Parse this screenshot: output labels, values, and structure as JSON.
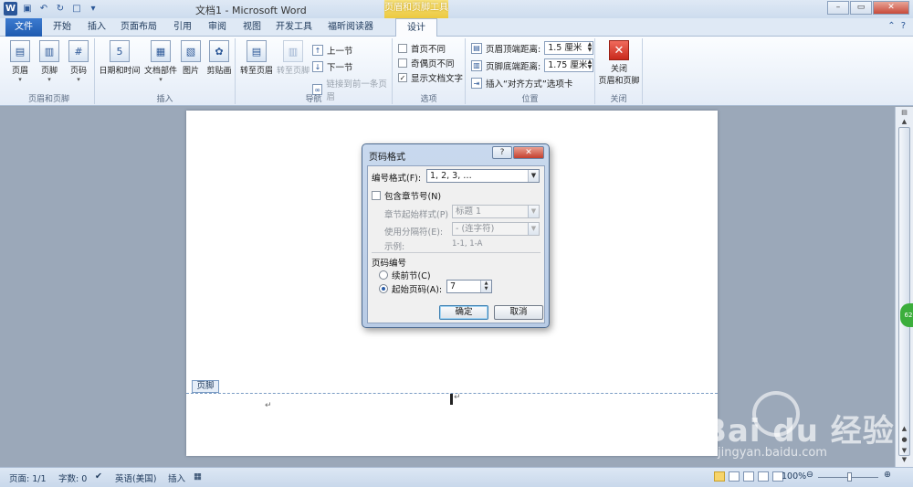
{
  "window": {
    "title": "文档1 - Microsoft Word",
    "context_tab_group": "页眉和页脚工具"
  },
  "tabs": [
    "文件",
    "开始",
    "插入",
    "页面布局",
    "引用",
    "审阅",
    "视图",
    "开发工具",
    "福昕阅读器",
    "设计"
  ],
  "ribbon": {
    "group1": {
      "label": "页眉和页脚",
      "buttons": [
        "页眉",
        "页脚",
        "页码"
      ]
    },
    "group2": {
      "label": "插入",
      "buttons": [
        "日期和时间",
        "文档部件",
        "图片",
        "剪贴画"
      ]
    },
    "group3": {
      "label": "导航",
      "goto_header": "转至页眉",
      "goto_footer": "转至页脚",
      "prev": "上一节",
      "next": "下一节",
      "link_prev": "链接到前一条页眉"
    },
    "group4": {
      "label": "选项",
      "checks": [
        {
          "label": "首页不同",
          "checked": false
        },
        {
          "label": "奇偶页不同",
          "checked": false
        },
        {
          "label": "显示文档文字",
          "checked": true
        }
      ]
    },
    "group5": {
      "label": "位置",
      "header_dist_label": "页眉顶端距离:",
      "header_dist_value": "1.5 厘米",
      "footer_dist_label": "页脚底端距离:",
      "footer_dist_value": "1.75 厘米",
      "insert_align": "插入“对齐方式”选项卡"
    },
    "group6": {
      "label": "关闭",
      "close_line1": "关闭",
      "close_line2": "页眉和页脚"
    }
  },
  "document": {
    "footer_tag": "页脚"
  },
  "dialog": {
    "title": "页码格式",
    "number_format_label": "编号格式(F):",
    "number_format_value": "1, 2, 3, …",
    "include_chapter_label": "包含章节号(N)",
    "chapter_style_label": "章节起始样式(P)",
    "chapter_style_value": "标题 1",
    "separator_label": "使用分隔符(E):",
    "separator_value": "-  (连字符)",
    "example_label": "示例:",
    "example_value": "1-1, 1-A",
    "section_title": "页码编号",
    "continue_label": "续前节(C)",
    "start_at_label": "起始页码(A):",
    "start_at_value": "7",
    "ok": "确定",
    "cancel": "取消"
  },
  "statusbar": {
    "page": "页面: 1/1",
    "words": "字数: 0",
    "language": "英语(美国)",
    "mode": "插入",
    "zoom": "100%"
  },
  "watermark": {
    "brand": "Bai du 经验",
    "url": "jingyan.baidu.com"
  },
  "side_badge": "62"
}
